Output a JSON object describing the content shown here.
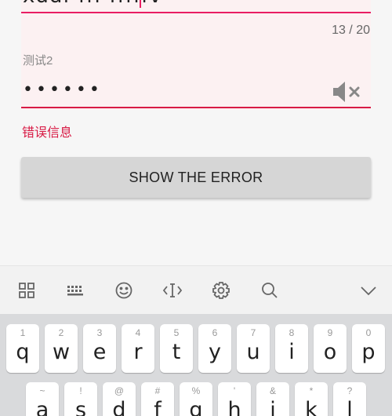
{
  "form": {
    "field1": {
      "value": "xddf fff fffffv",
      "counter": "13 / 20"
    },
    "field2": {
      "label": "测试2",
      "value": "••••••",
      "toggle_icon": "volume-muted-icon"
    },
    "error_message": "错误信息",
    "show_error_button": "SHOW THE ERROR"
  },
  "keyboard_toolbar": {
    "icons": [
      "apps-grid-icon",
      "keyboard-icon",
      "emoji-icon",
      "text-cursor-icon",
      "settings-gear-icon",
      "search-icon",
      "chevron-down-icon"
    ]
  },
  "keyboard": {
    "row1": [
      {
        "hint": "1",
        "key": "q"
      },
      {
        "hint": "2",
        "key": "w"
      },
      {
        "hint": "3",
        "key": "e"
      },
      {
        "hint": "4",
        "key": "r"
      },
      {
        "hint": "5",
        "key": "t"
      },
      {
        "hint": "6",
        "key": "y"
      },
      {
        "hint": "7",
        "key": "u"
      },
      {
        "hint": "8",
        "key": "i"
      },
      {
        "hint": "9",
        "key": "o"
      },
      {
        "hint": "0",
        "key": "p"
      }
    ],
    "row2": [
      {
        "hint": "~",
        "key": "a"
      },
      {
        "hint": "!",
        "key": "s"
      },
      {
        "hint": "@",
        "key": "d"
      },
      {
        "hint": "#",
        "key": "f"
      },
      {
        "hint": "%",
        "key": "g"
      },
      {
        "hint": "'",
        "key": "h"
      },
      {
        "hint": "&",
        "key": "j"
      },
      {
        "hint": "*",
        "key": "k"
      },
      {
        "hint": "?",
        "key": "l"
      }
    ]
  },
  "colors": {
    "accent": "#e91e63",
    "error": "#d81b45",
    "field_bg": "#fcf1f2"
  }
}
